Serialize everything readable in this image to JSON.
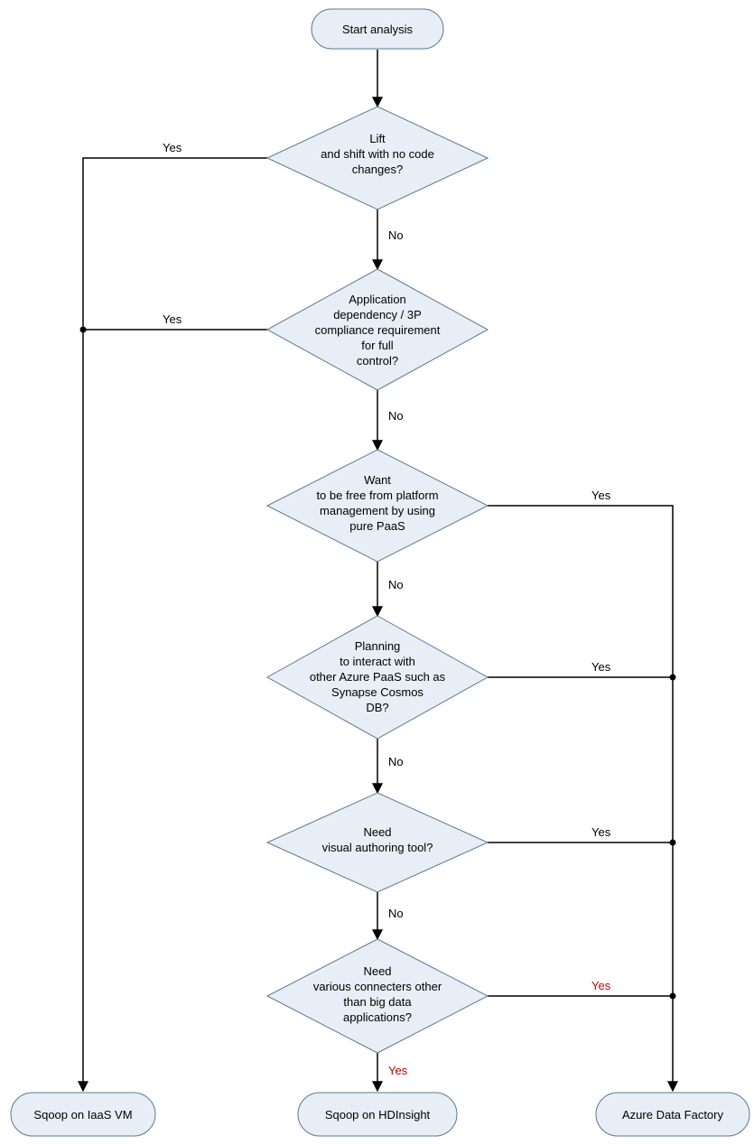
{
  "start": {
    "title": "Start analysis"
  },
  "decisions": {
    "d1": {
      "l1": "Lift",
      "l2": "and shift with no code",
      "l3": "changes?"
    },
    "d2": {
      "l1": "Application",
      "l2": "dependency / 3P",
      "l3": "compliance requirement",
      "l4": "for full",
      "l5": "control?"
    },
    "d3": {
      "l1": "Want",
      "l2": "to be free from platform",
      "l3": "management by using",
      "l4": "pure PaaS"
    },
    "d4": {
      "l1": "Planning",
      "l2": "to interact with",
      "l3": "other Azure PaaS such as",
      "l4": "Synapse Cosmos",
      "l5": "DB?"
    },
    "d5": {
      "l1": "Need",
      "l2": "visual authoring tool?"
    },
    "d6": {
      "l1": "Need",
      "l2": "various connecters other",
      "l3": "than big data",
      "l4": "applications?"
    }
  },
  "terminals": {
    "t1": "Sqoop on IaaS VM",
    "t2": "Sqoop on HDInsight",
    "t3": "Azure Data Factory"
  },
  "labels": {
    "yes": "Yes",
    "no": "No"
  }
}
